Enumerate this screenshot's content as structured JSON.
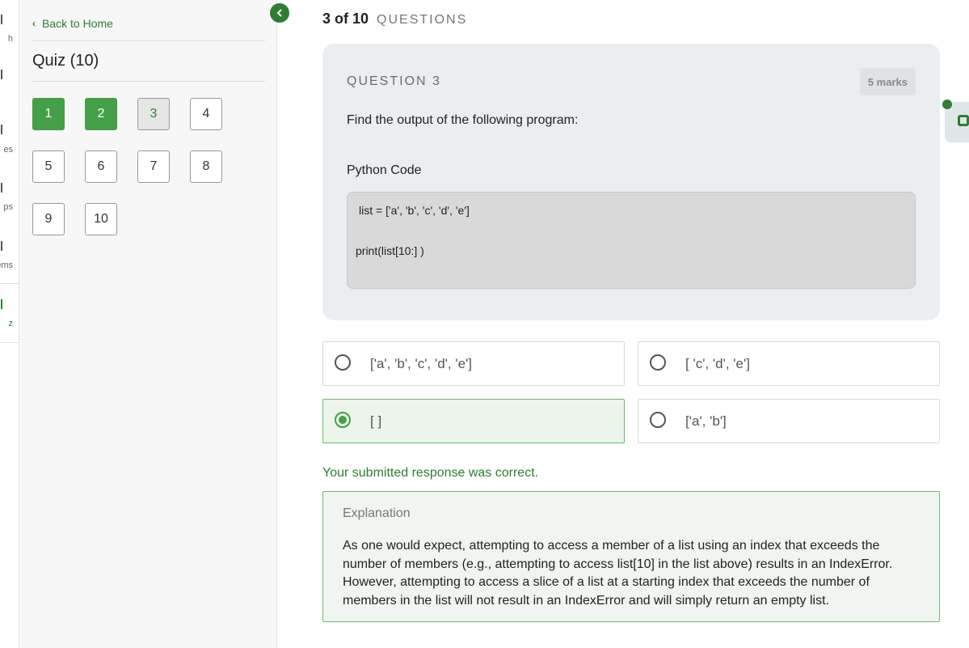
{
  "rail": {
    "items": [
      "h",
      "es",
      "ps",
      "ems",
      "z"
    ]
  },
  "panel": {
    "back_label": "Back to Home",
    "quiz_title": "Quiz (10)",
    "questions": [
      {
        "label": "1",
        "state": "answered"
      },
      {
        "label": "2",
        "state": "answered"
      },
      {
        "label": "3",
        "state": "current"
      },
      {
        "label": "4",
        "state": "unanswered"
      },
      {
        "label": "5",
        "state": "unanswered"
      },
      {
        "label": "6",
        "state": "unanswered"
      },
      {
        "label": "7",
        "state": "unanswered"
      },
      {
        "label": "8",
        "state": "unanswered"
      },
      {
        "label": "9",
        "state": "unanswered"
      },
      {
        "label": "10",
        "state": "unanswered"
      }
    ]
  },
  "counter": {
    "value": "3 of 10",
    "label": "QUESTIONS"
  },
  "question": {
    "heading": "QUESTION 3",
    "marks": "5 marks",
    "text": "Find the output of the following program:",
    "code_label": "Python Code",
    "code_line1": "list = ['a', 'b', 'c', 'd', 'e']",
    "code_line2": "print(list[10:] )"
  },
  "options": [
    {
      "text": "['a', 'b', 'c', 'd', 'e']",
      "selected": false
    },
    {
      "text": "[ 'c', 'd', 'e']",
      "selected": false
    },
    {
      "text": "[ ]",
      "selected": true
    },
    {
      "text": "['a', 'b']",
      "selected": false
    }
  ],
  "feedback": "Your submitted response was correct.",
  "explanation": {
    "title": "Explanation",
    "body": "As one would expect, attempting to access a member of a list using an index that exceeds the number of members (e.g., attempting to access list[10] in the list above) results in an IndexError. However, attempting to access a slice of a list at a starting index that exceeds the number of members in the list will not result in an IndexError and will simply return an empty list."
  },
  "colors": {
    "accent": "#2e7d32",
    "answered": "#43a047",
    "card_bg": "#ebeef0",
    "selected_bg": "#ebf5ea"
  },
  "icons": {
    "back": "chevron-left-icon",
    "collapse": "chevron-left-icon",
    "chat": "chat-icon"
  }
}
